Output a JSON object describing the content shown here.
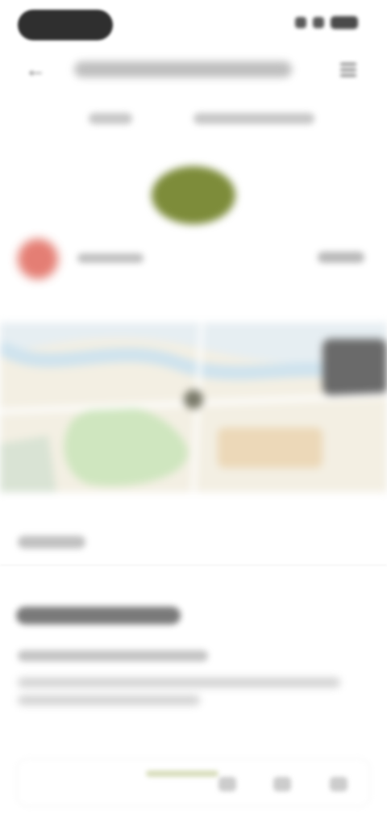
{
  "theme": {
    "background": "#ffffff",
    "status_pill_color": "#2f2f2f",
    "brand_color": "#7d8c3a",
    "avatar_color": "#e0685c",
    "map_water_color": "#cfe3ee",
    "map_park_color": "#cfe6bf",
    "map_land_color": "#f3efe3"
  },
  "status_bar": {
    "icons": [
      "signal-icon",
      "wifi-icon",
      "battery-icon"
    ]
  },
  "header": {
    "back_icon": "back-arrow-icon",
    "menu_icon": "menu-icon"
  },
  "brand": {
    "logo_icon": "brand-logo-icon"
  },
  "profile": {
    "avatar_icon": "avatar-icon"
  },
  "map": {
    "icon": "map-icon"
  },
  "bottom_bar": {
    "icons": [
      "home-icon",
      "search-icon",
      "profile-icon"
    ]
  }
}
